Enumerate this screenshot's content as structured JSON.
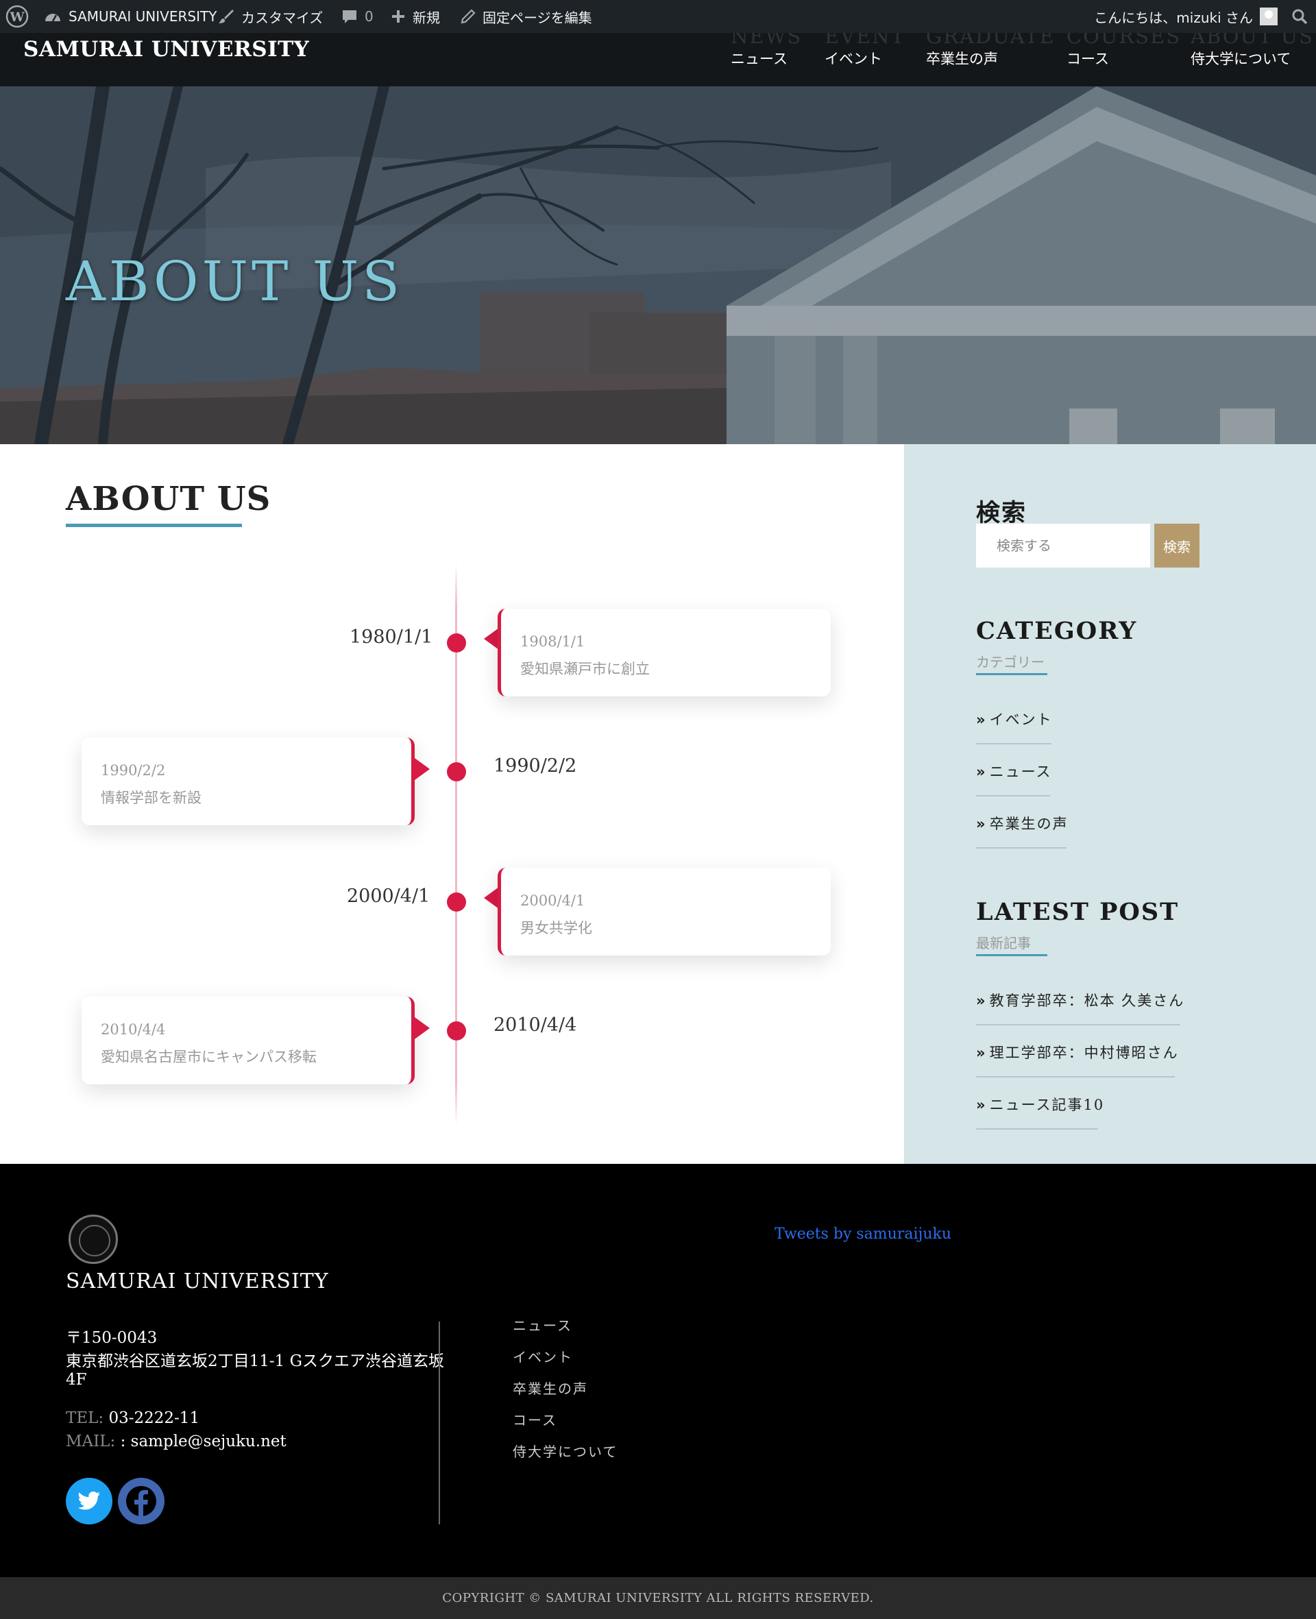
{
  "admin_bar": {
    "site_name": "SAMURAI UNIVERSITY",
    "customize": "カスタマイズ",
    "comments_count": "0",
    "new": "新規",
    "edit_page": "固定ページを編集",
    "greeting": "こんにちは、mizuki さん"
  },
  "header": {
    "site_title": "SAMURAI UNIVERSITY",
    "nav": [
      {
        "en": "NEWS",
        "jp": "ニュース"
      },
      {
        "en": "EVENT",
        "jp": "イベント"
      },
      {
        "en": "GRADUATE",
        "jp": "卒業生の声"
      },
      {
        "en": "COURSES",
        "jp": "コース"
      },
      {
        "en": "ABOUT US",
        "jp": "侍大学について"
      }
    ]
  },
  "hero": {
    "title": "ABOUT US"
  },
  "main": {
    "heading": "ABOUT US",
    "timeline": [
      {
        "side_date": "1980/1/1",
        "card_date": "1908/1/1",
        "card_text": "愛知県瀬戸市に創立"
      },
      {
        "side_date": "1990/2/2",
        "card_date": "1990/2/2",
        "card_text": "情報学部を新設"
      },
      {
        "side_date": "2000/4/1",
        "card_date": "2000/4/1",
        "card_text": "男女共学化"
      },
      {
        "side_date": "2010/4/4",
        "card_date": "2010/4/4",
        "card_text": "愛知県名古屋市にキャンパス移転"
      }
    ]
  },
  "sidebar": {
    "search_title": "検索",
    "search_placeholder": "検索する",
    "search_button": "検索",
    "category_title": "CATEGORY",
    "category_sub": "カテゴリー",
    "categories": [
      "イベント",
      "ニュース",
      "卒業生の声"
    ],
    "latest_title": "LATEST POST",
    "latest_sub": "最新記事",
    "latest_posts": [
      "教育学部卒：松本 久美さん",
      "理工学部卒：中村博昭さん",
      "ニュース記事10"
    ]
  },
  "footer": {
    "title": "SAMURAI UNIVERSITY",
    "postal": "〒150-0043",
    "address_line1": "東京都渋谷区道玄坂2丁目11-1 Gスクエア渋谷道玄坂",
    "address_line2": "4F",
    "tel_label": "TEL:",
    "tel": "03-2222-11",
    "mail_label": "MAIL:",
    "mail": ": sample@sejuku.net",
    "nav": [
      "ニュース",
      "イベント",
      "卒業生の声",
      "コース",
      "侍大学について"
    ],
    "tweets_link": "Tweets by samuraijuku",
    "copyright": "COPYRIGHT © SAMURAI UNIVERSITY ALL RIGHTS RESERVED."
  },
  "colors": {
    "accent_blue": "#4b9bb6",
    "timeline_red": "#d71b45",
    "sidebar_bg": "#d6e5e7",
    "search_button": "#b59b6c",
    "twitter": "#1da1f2",
    "facebook": "#4267b2"
  }
}
